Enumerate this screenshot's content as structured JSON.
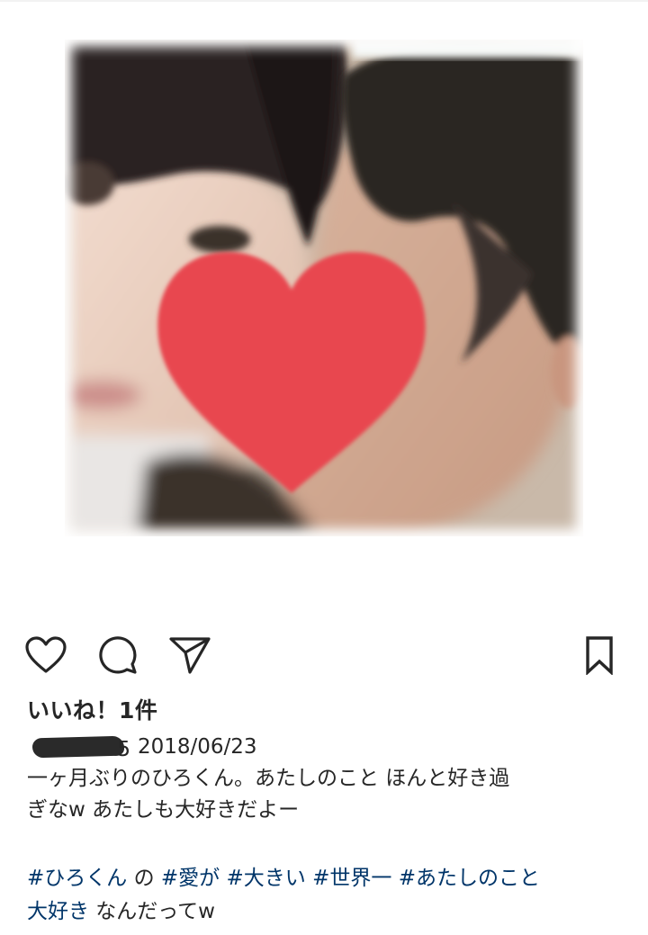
{
  "post": {
    "likes_label": "いいね！1件",
    "username_tail": "5",
    "date": "2018/06/23",
    "caption_line1": "一ヶ月ぶりのひろくん。あたしのこと ほんと好き過",
    "caption_line2": "ぎなw あたしも大好きだよー",
    "tags_line": [
      {
        "type": "tag",
        "text": "#ひろくん"
      },
      {
        "type": "text",
        "text": " の "
      },
      {
        "type": "tag",
        "text": "#愛が"
      },
      {
        "type": "text",
        "text": " "
      },
      {
        "type": "tag",
        "text": "#大きい"
      },
      {
        "type": "text",
        "text": " "
      },
      {
        "type": "tag",
        "text": "#世界一"
      },
      {
        "type": "text",
        "text": " "
      },
      {
        "type": "tag",
        "text": "#あたしのこと"
      },
      {
        "type": "text",
        "text": " "
      },
      {
        "type": "tag",
        "text": "大好き"
      },
      {
        "type": "text",
        "text": " なんだってw"
      }
    ]
  },
  "icons": {
    "like": "heart-outline-icon",
    "comment": "comment-bubble-icon",
    "share": "paper-plane-icon",
    "save": "bookmark-icon",
    "photo_sticker": "red-heart-sticker"
  },
  "colors": {
    "hashtag": "#003569",
    "text": "#262626",
    "heart_sticker": "#e8474f"
  }
}
